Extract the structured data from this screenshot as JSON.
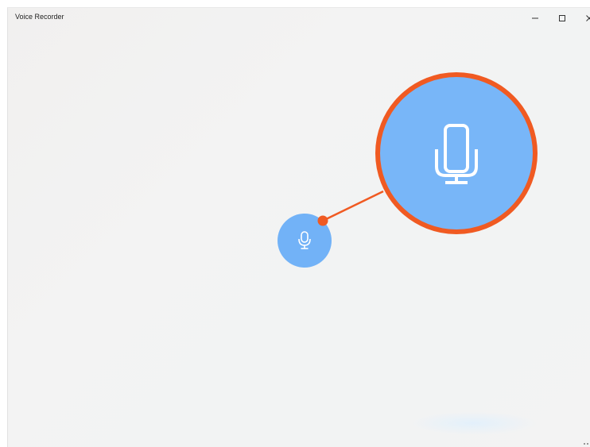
{
  "window": {
    "title": "Voice Recorder"
  },
  "controls": {
    "minimize_icon": "minimize-icon",
    "maximize_icon": "maximize-icon",
    "close_icon": "close-icon"
  },
  "record_button": {
    "icon": "microphone-icon",
    "color": "#72b2f7"
  },
  "callout": {
    "icon": "microphone-icon",
    "fill": "#78b6f8",
    "ring_color": "#f05a22"
  }
}
